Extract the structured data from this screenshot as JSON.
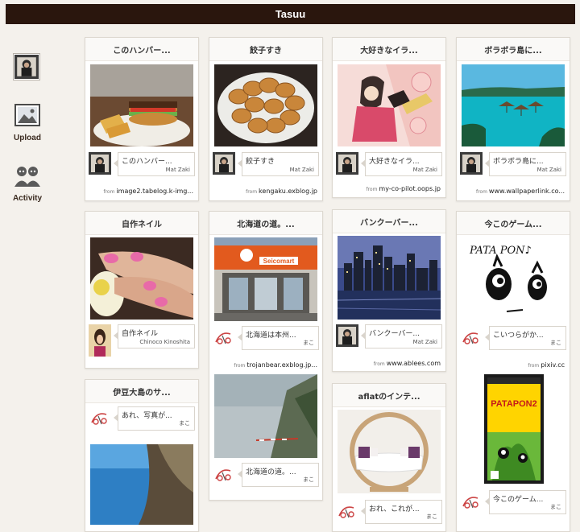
{
  "app": {
    "title": "Tasuu"
  },
  "sidebar": {
    "upload_label": "Upload",
    "activity_label": "Activity"
  },
  "source_prefix": "from",
  "cards": [
    {
      "title": "このハンバー...",
      "comment": "このハンバー...",
      "user": "Mat Zaki",
      "source": "image2.tabelog.k-img..."
    },
    {
      "title": "餃子すき",
      "comment": "餃子すき",
      "user": "Mat Zaki",
      "source": "kengaku.exblog.jp"
    },
    {
      "title": "大好きなイラ...",
      "comment": "大好きなイラ...",
      "user": "Mat Zaki",
      "source": "my-co-pilot.oops.jp"
    },
    {
      "title": "ボラボラ島に...",
      "comment": "ボラボラ島に...",
      "user": "Mat Zaki",
      "source": "www.wallpaperlink.co..."
    },
    {
      "title": "自作ネイル",
      "comment": "自作ネイル",
      "user": "Chinoco Kinoshita"
    },
    {
      "title": "北海道の道。...",
      "comment": "北海道は本州...",
      "user": "まこ",
      "source": "trojanbear.exblog.jp...",
      "comment2": "北海道の道。...",
      "user2": "まこ"
    },
    {
      "title": "バンクーバー...",
      "comment": "バンクーバー...",
      "user": "Mat Zaki",
      "source": "www.ablees.com"
    },
    {
      "title": "今このゲーム...",
      "comment": "こいつらがか...",
      "user": "まこ",
      "source": "pixiv.cc",
      "comment2": "今このゲーム...",
      "user2": "まこ",
      "art_text": "PATA PON♪",
      "box_title": "PATAPON2"
    },
    {
      "title": "伊豆大島のサ...",
      "comment": "あれ、写真が...",
      "user": "まこ"
    },
    {
      "title": "aflatのインテ...",
      "comment": "おれ、これが...",
      "user": "まこ"
    }
  ],
  "store_sign": "Seicomart"
}
